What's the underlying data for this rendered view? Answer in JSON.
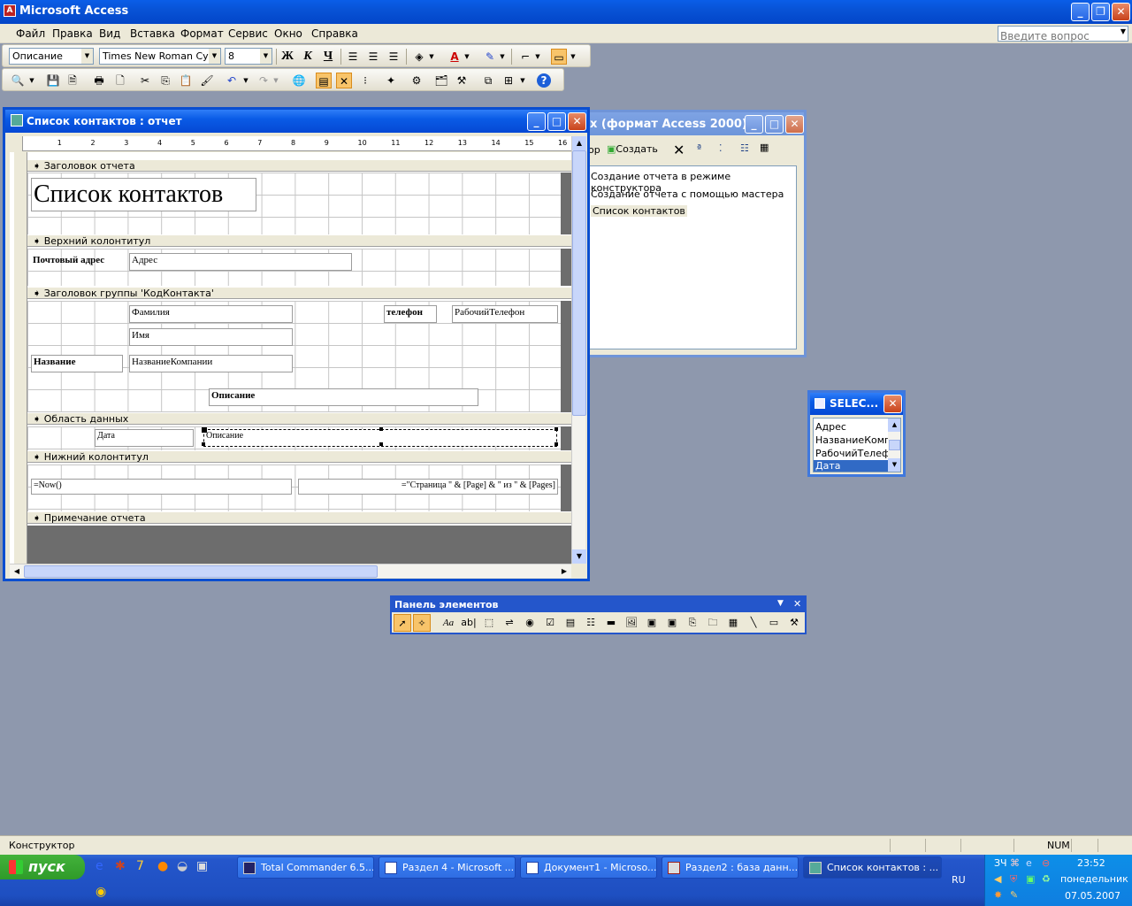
{
  "app": {
    "title": "Microsoft Access"
  },
  "menu": [
    "Файл",
    "Правка",
    "Вид",
    "Вставка",
    "Формат",
    "Сервис",
    "Окно",
    "Справка"
  ],
  "help_box": {
    "placeholder": "Введите вопрос"
  },
  "formatting_toolbar": {
    "object_combo": "Описание",
    "font_combo": "Times New Roman Cyr",
    "size_combo": "8",
    "bold": "Ж",
    "italic": "К",
    "underline": "Ч"
  },
  "report_window": {
    "title": "Список контактов : отчет",
    "ruler": [
      "1",
      "2",
      "3",
      "4",
      "5",
      "6",
      "7",
      "8",
      "9",
      "10",
      "11",
      "12",
      "13",
      "14",
      "15",
      "16"
    ],
    "sections": {
      "report_header": "Заголовок отчета",
      "page_header": "Верхний колонтитул",
      "group_header": "Заголовок группы 'КодКонтакта'",
      "detail": "Область данных",
      "page_footer": "Нижний колонтитул",
      "report_footer": "Примечание отчета"
    },
    "controls": {
      "report_title": "Список контактов",
      "postal_label": "Почтовый адрес",
      "address_field": "Адрес",
      "lastname_field": "Фамилия",
      "firstname_field": "Имя",
      "company_label": "Название",
      "company_field": "НазваниеКомпании",
      "description_label": "Описание",
      "phone_label": "телефон",
      "phone_field": "РабочийТелефон",
      "date_field": "Дата",
      "description_field": "Описание",
      "now_field": "=Now()",
      "page_field": "=\"Страница \" & [Page] & \" из \" & [Pages]"
    }
  },
  "db_window": {
    "title": "х (формат Access 2000)",
    "toolbar_open": "ор",
    "toolbar_create": "Создать",
    "items": [
      "Создание отчета в режиме конструктора",
      "Создание отчета с помощью мастера",
      "Список контактов"
    ]
  },
  "field_list": {
    "title": "SELEC...",
    "items": [
      "Адрес",
      "НазваниеКомпании",
      "РабочийТелефон",
      "Дата"
    ],
    "selected": "Дата"
  },
  "toolbox": {
    "title": "Панель элементов"
  },
  "status": {
    "text": "Конструктор",
    "num": "NUM"
  },
  "taskbar": {
    "start": "пуск",
    "tasks": [
      "Total Commander 6.5...",
      "Раздел 4 - Microsoft ...",
      "Документ1 - Microso...",
      "Раздел2 : база данн...",
      "Список контактов : ..."
    ],
    "lang": "RU",
    "time": "23:52",
    "day": "понедельник",
    "date": "07.05.2007"
  }
}
